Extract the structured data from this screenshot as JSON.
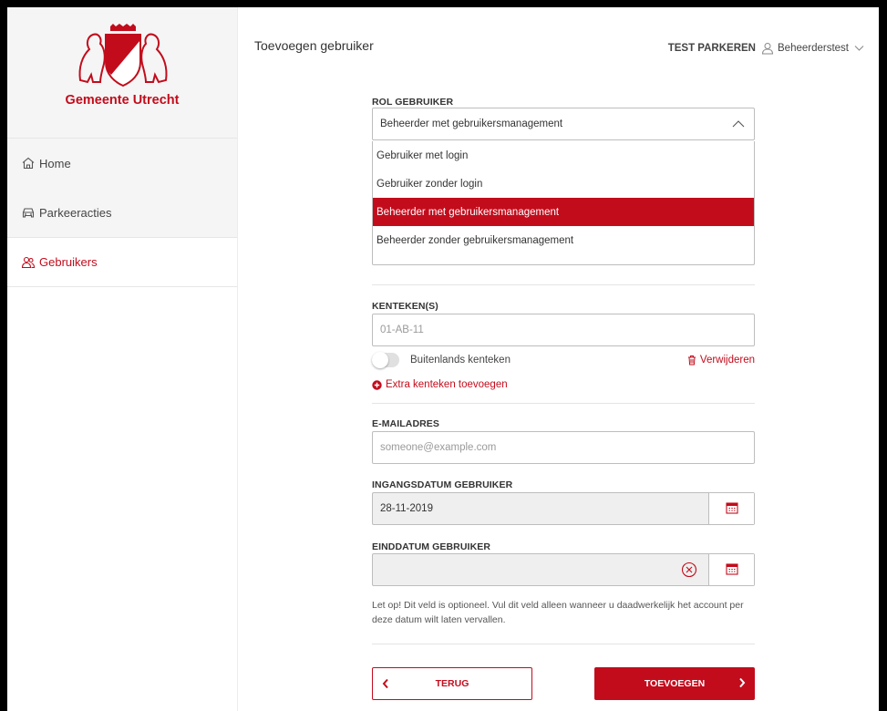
{
  "sidebar": {
    "logo_text": "Gemeente Utrecht",
    "items": [
      {
        "label": "Home",
        "icon": "home-icon"
      },
      {
        "label": "Parkeeracties",
        "icon": "car-icon"
      },
      {
        "label": "Gebruikers",
        "icon": "users-icon",
        "active": true
      }
    ]
  },
  "header": {
    "page_title": "Toevoegen gebruiker",
    "organization": "TEST PARKEREN",
    "user_name": "Beheerderstest"
  },
  "form": {
    "role": {
      "label": "ROL GEBRUIKER",
      "selected": "Beheerder met gebruikersmanagement",
      "options": [
        "Gebruiker met login",
        "Gebruiker zonder login",
        "Beheerder met gebruikersmanagement",
        "Beheerder zonder gebruikersmanagement"
      ]
    },
    "plates": {
      "label": "KENTEKEN(S)",
      "placeholder": "01-AB-11",
      "foreign_toggle_label": "Buitenlands kenteken",
      "remove_label": "Verwijderen",
      "add_label": "Extra kenteken toevoegen"
    },
    "email": {
      "label": "E-MAILADRES",
      "placeholder": "someone@example.com"
    },
    "start_date": {
      "label": "INGANGSDATUM GEBRUIKER",
      "value": "28-11-2019"
    },
    "end_date": {
      "label": "EINDDATUM GEBRUIKER",
      "value": "",
      "note": "Let op! Dit veld is optioneel. Vul dit veld alleen wanneer u daadwerkelijk het account per deze datum wilt laten vervallen."
    },
    "buttons": {
      "back": "TERUG",
      "submit": "TOEVOEGEN"
    }
  },
  "colors": {
    "accent": "#c20c1c",
    "sidebar_bg": "#f5f5f5",
    "border": "#bdbdbd"
  }
}
